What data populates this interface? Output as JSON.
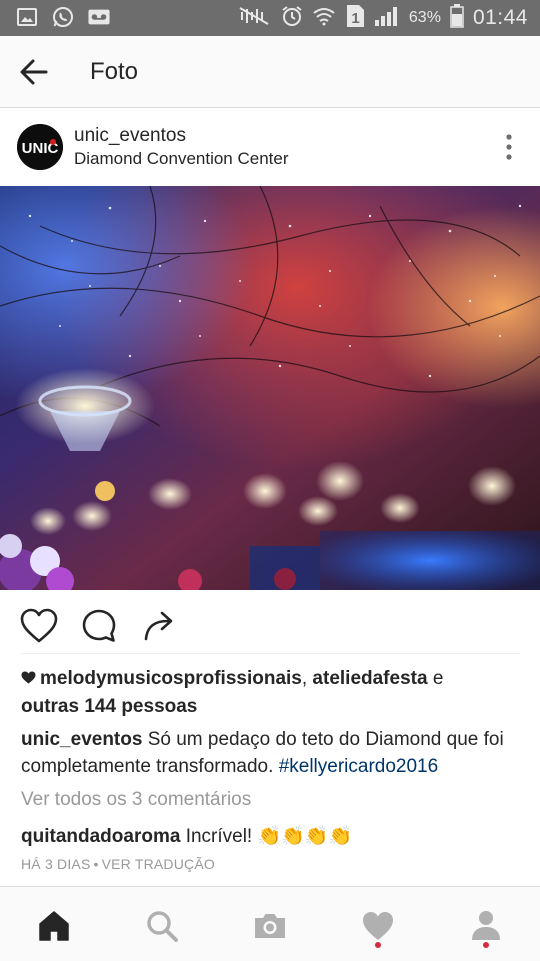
{
  "status_bar": {
    "battery_percent": "63%",
    "time": "01:44",
    "left_icons": [
      "image-icon",
      "whatsapp-icon",
      "voicemail-icon"
    ],
    "right_icons": [
      "mute-icon",
      "alarm-icon",
      "wifi-icon",
      "sim-1-icon",
      "signal-icon",
      "battery-icon"
    ]
  },
  "app_bar": {
    "title": "Foto",
    "back_icon": "arrow-left-icon"
  },
  "post": {
    "avatar_text": "UNIC",
    "username": "unic_eventos",
    "location": "Diamond Convention Center",
    "likes": {
      "user1": "melodymusicosprofissionais",
      "separator": ",",
      "user2": "ateliedafesta",
      "conjunction": "e",
      "others": "outras 144 pessoas"
    },
    "caption": {
      "username": "unic_eventos",
      "text": "Só um pedaço do teto do Diamond que foi completamente transformado.",
      "hashtag": "#kellyericardo2016"
    },
    "view_comments": "Ver todos os 3 comentários",
    "comment": {
      "username": "quitandadoaroma",
      "text": "Incrível!",
      "emoji": "👏👏👏👏"
    },
    "timestamp": "HÁ 3 DIAS",
    "meta_separator": "•",
    "translate": "VER TRADUÇÃO"
  },
  "colors": {
    "status_bar": "#6d6d6d",
    "text": "#262626",
    "muted": "#999999",
    "hashtag": "#003569",
    "notification": "#d62a3d"
  },
  "bottom_nav": [
    "home-icon",
    "search-icon",
    "camera-icon",
    "heart-icon",
    "profile-icon"
  ]
}
